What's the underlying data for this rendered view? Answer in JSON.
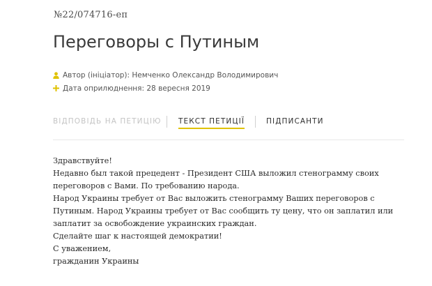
{
  "petition": {
    "number": "№22/074716-еп",
    "title": "Переговоры с Путиным"
  },
  "meta": {
    "author_label": "Автор (ініціатор): ",
    "author_value": "Немченко Олександр Володимирович",
    "date_label": "Дата оприлюднення: ",
    "date_value": "28 вересня 2019",
    "icon_color": "#e0c200"
  },
  "tabs": {
    "response": "ВІДПОВІДЬ НА ПЕТИЦІЮ",
    "text": "ТЕКСТ ПЕТИЦІЇ",
    "signers": "ПІДПИСАНТИ",
    "active": "text",
    "accent_color": "#e0c200"
  },
  "body": {
    "lines": [
      "Здравствуйте!",
      "Недавно был такой прецедент - Президент США выложил стенограмму своих переговоров с Вами. По требованию народа.",
      "Народ Украины требует от Вас выложить стенограмму Ваших переговоров с Путиным. Народ Украины требует от Вас сообщить ту цену, что он заплатил или заплатит за освобождение украинских граждан.",
      "Сделайте шаг к настоящей демократии!",
      "С уважением,",
      "гражданин Украины"
    ]
  }
}
